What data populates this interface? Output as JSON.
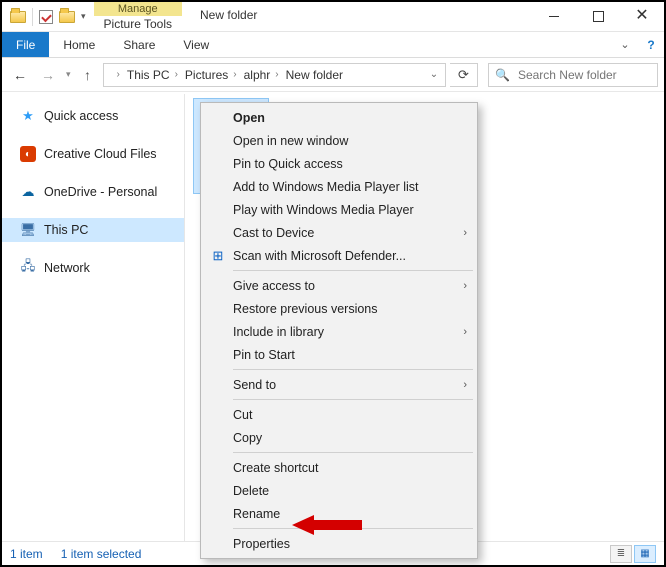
{
  "window": {
    "title": "New folder",
    "contextual_group": "Manage",
    "contextual_tab": "Picture Tools"
  },
  "ribbon": {
    "file": "File",
    "tabs": [
      "Home",
      "Share",
      "View"
    ]
  },
  "nav": {
    "breadcrumbs": [
      "This PC",
      "Pictures",
      "alphr",
      "New folder"
    ],
    "search_placeholder": "Search New folder"
  },
  "sidebar": {
    "items": [
      {
        "icon": "star",
        "label": "Quick access"
      },
      {
        "icon": "cc",
        "label": "Creative Cloud Files"
      },
      {
        "icon": "od",
        "label": "OneDrive - Personal"
      },
      {
        "icon": "pc",
        "label": "This PC",
        "selected": true
      },
      {
        "icon": "net",
        "label": "Network"
      }
    ]
  },
  "context_menu": {
    "items": [
      {
        "label": "Open",
        "bold": true
      },
      {
        "label": "Open in new window"
      },
      {
        "label": "Pin to Quick access"
      },
      {
        "label": "Add to Windows Media Player list"
      },
      {
        "label": "Play with Windows Media Player"
      },
      {
        "label": "Cast to Device",
        "submenu": true
      },
      {
        "label": "Scan with Microsoft Defender...",
        "icon": "defender"
      },
      {
        "sep": true
      },
      {
        "label": "Give access to",
        "submenu": true
      },
      {
        "label": "Restore previous versions"
      },
      {
        "label": "Include in library",
        "submenu": true
      },
      {
        "label": "Pin to Start"
      },
      {
        "sep": true
      },
      {
        "label": "Send to",
        "submenu": true
      },
      {
        "sep": true
      },
      {
        "label": "Cut"
      },
      {
        "label": "Copy"
      },
      {
        "sep": true
      },
      {
        "label": "Create shortcut"
      },
      {
        "label": "Delete"
      },
      {
        "label": "Rename"
      },
      {
        "sep": true
      },
      {
        "label": "Properties"
      }
    ]
  },
  "status": {
    "count": "1 item",
    "selection": "1 item selected"
  }
}
